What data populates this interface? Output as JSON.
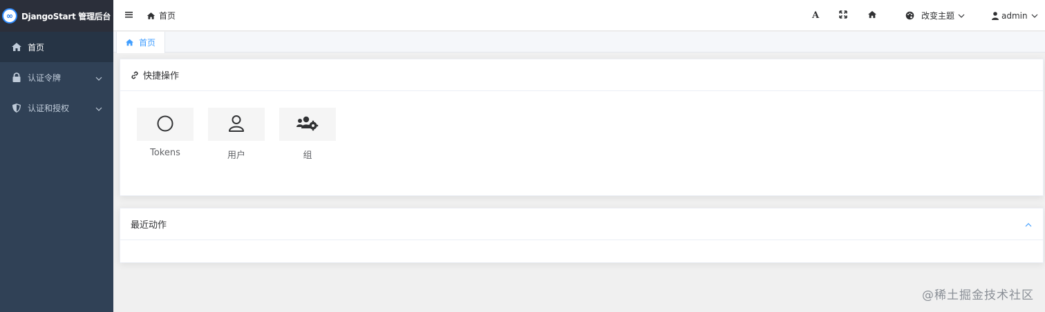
{
  "app": {
    "title": "DjangoStart 管理后台",
    "logo_glyph": "∞"
  },
  "sidebar": {
    "bg_color": "#304156",
    "items": [
      {
        "label": "首页",
        "icon": "home-icon",
        "active": true
      },
      {
        "label": "认证令牌",
        "icon": "lock-icon",
        "has_submenu": true
      },
      {
        "label": "认证和授权",
        "icon": "shield-icon",
        "has_submenu": true
      }
    ]
  },
  "navbar": {
    "breadcrumb": "首页",
    "font_size_glyph": "A",
    "theme_label": "改变主题",
    "user_label": "admin"
  },
  "tags": {
    "active_tag": "首页",
    "accent_color": "#409eff"
  },
  "quick_actions": {
    "title": "快捷操作",
    "items": [
      {
        "label": "Tokens",
        "icon": "circle-icon"
      },
      {
        "label": "用户",
        "icon": "user-icon"
      },
      {
        "label": "组",
        "icon": "users-cog-icon"
      }
    ]
  },
  "recent_actions": {
    "title": "最近动作"
  },
  "watermark": "@稀土掘金技术社区"
}
